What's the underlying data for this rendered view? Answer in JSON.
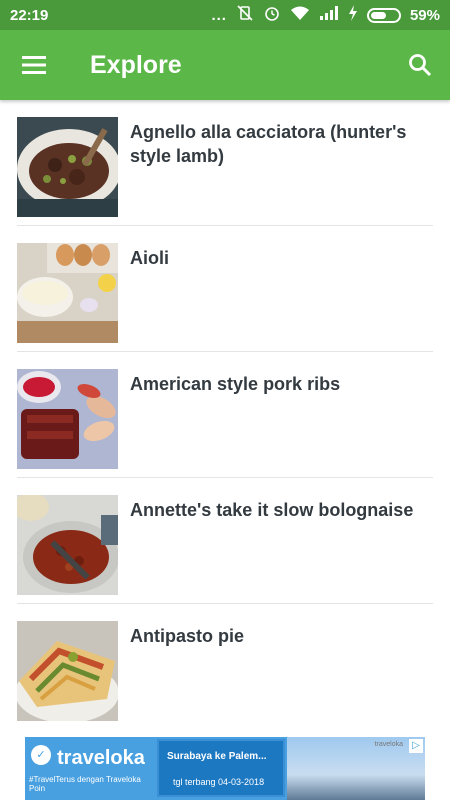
{
  "status": {
    "time": "22:19",
    "dots": "...",
    "battery_percent": "59%",
    "battery_level": 0.59
  },
  "app_bar": {
    "title": "Explore",
    "menu_icon": "hamburger-menu-icon",
    "search_icon": "search-icon",
    "color": "#5cb749"
  },
  "recipes": [
    {
      "title": "Agnello alla cacciatora (hunter's style lamb)",
      "image": "lamb-stew"
    },
    {
      "title": "Aioli",
      "image": "aioli-bowl"
    },
    {
      "title": "American style pork ribs",
      "image": "pork-ribs"
    },
    {
      "title": "Annette's take it slow bolognaise",
      "image": "bolognaise-pot"
    },
    {
      "title": "Antipasto pie",
      "image": "antipasto-pie"
    }
  ],
  "ad": {
    "brand": "traveloka",
    "tagline": "#TravelTerus dengan Traveloka Poin",
    "promo_title": "Surabaya ke Palem...",
    "promo_date": "tgl terbang 04-03-2018",
    "brand_small": "traveloka"
  }
}
